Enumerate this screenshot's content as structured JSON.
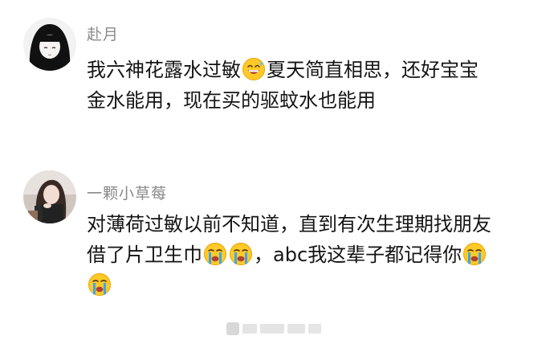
{
  "comments": [
    {
      "username": "赴月",
      "lines": [
        {
          "before": "我六神花露水过敏",
          "emoji": "grin-sweat-emoji",
          "after": "夏天简直相思，还好宝宝"
        },
        {
          "text": "金水能用，现在买的驱蚊水也能用"
        }
      ]
    },
    {
      "username": "一颗小草莓",
      "lines": [
        {
          "text": "对薄荷过敏以前不知道，直到有次生理期找朋友"
        },
        {
          "before": "借了片卫生巾",
          "after": "，abc我这辈子都记得你"
        },
        {
          "text": ""
        }
      ]
    }
  ],
  "emoji_colors": {
    "face": "#FFC928",
    "outline": "#E8A400",
    "tear": "#3AA6F0",
    "mouth": "#B0432E",
    "sweat": "#6EC3F5"
  }
}
